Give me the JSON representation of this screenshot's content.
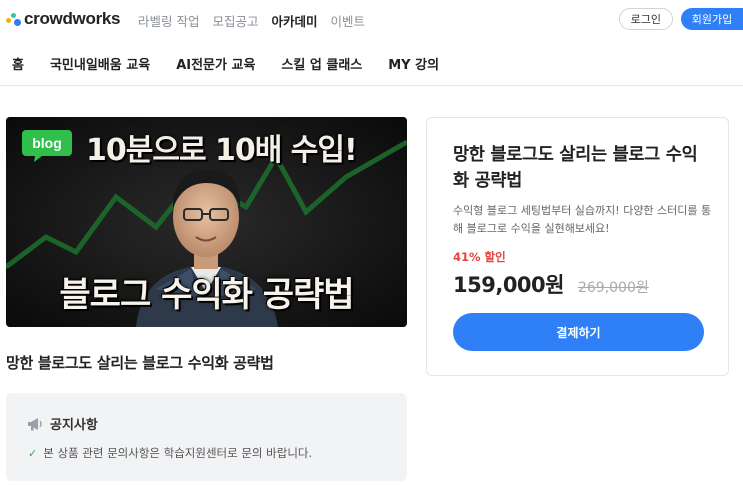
{
  "brand": {
    "name": "crowdworks"
  },
  "top_nav": {
    "items": [
      {
        "label": "라벨링 작업",
        "active": false
      },
      {
        "label": "모집공고",
        "active": false
      },
      {
        "label": "아카데미",
        "active": true
      },
      {
        "label": "이벤트",
        "active": false
      }
    ]
  },
  "auth": {
    "login_label": "로그인",
    "signup_label": "회원가입"
  },
  "sub_nav": {
    "items": [
      {
        "label": "홈"
      },
      {
        "label": "국민내일배움 교육"
      },
      {
        "label": "AI전문가 교육"
      },
      {
        "label": "스킬 업 클래스"
      },
      {
        "label": "MY 강의"
      }
    ]
  },
  "thumbnail": {
    "badge_text": "blog",
    "headline": "10분으로 10배 수입!",
    "subline": "블로그 수익화 공략법"
  },
  "course": {
    "title": "망한 블로그도 살리는 블로그 수익화 공략법"
  },
  "notice": {
    "heading": "공지사항",
    "line": "본 상품 관련 문의사항은 학습지원센터로 문의 바랍니다."
  },
  "purchase_card": {
    "title": "망한 블로그도 살리는 블로그 수익화 공략법",
    "description": "수익형 블로그 세팅법부터 실습까지! 다양한 스터디를 통해 블로그로 수익을 실현해보세요!",
    "discount_label": "41% 할인",
    "price": "159,000원",
    "original_price": "269,000원",
    "pay_button_label": "결제하기"
  },
  "colors": {
    "accent": "#2f80f6",
    "discount": "#e8413e",
    "badge_green": "#2fbf4a"
  }
}
